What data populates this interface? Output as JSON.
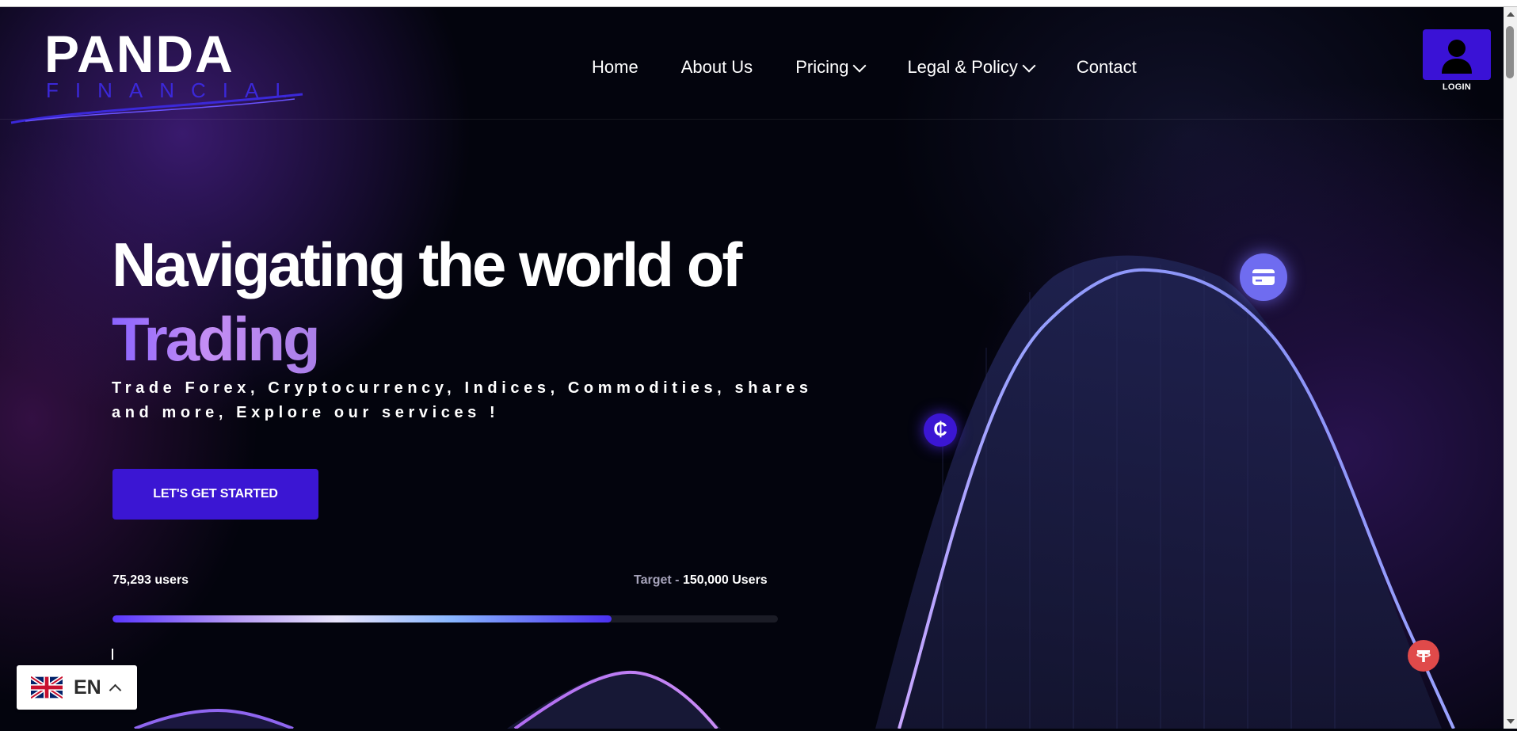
{
  "brand": {
    "name": "PANDA",
    "subtitle": "FINANCIAL"
  },
  "nav": {
    "items": [
      {
        "label": "Home",
        "dropdown": false
      },
      {
        "label": "About Us",
        "dropdown": false
      },
      {
        "label": "Pricing",
        "dropdown": true
      },
      {
        "label": "Legal & Policy",
        "dropdown": true
      },
      {
        "label": "Contact",
        "dropdown": false
      }
    ]
  },
  "login": {
    "label": "LOGIN",
    "icon": "user-icon"
  },
  "hero": {
    "headline_line1": "Navigating the world of",
    "headline_line2": "Trading",
    "subtext": "Trade Forex, Cryptocurrency, Indices, Commodities, shares and more, Explore our services !",
    "cta_label": "LET'S GET STARTED"
  },
  "progress": {
    "users_label": "75,293 users",
    "target_prefix": "Target - ",
    "target_value": "150,000 Users",
    "fraction": 0.75
  },
  "floating_icons": [
    "credit-card-icon",
    "crypto-coin-icon",
    "tether-icon"
  ],
  "language": {
    "code": "EN",
    "flag": "uk-flag-icon"
  },
  "colors": {
    "accent": "#3b16d3",
    "background": "#03040d",
    "curve": "#8d8ef5",
    "tether": "#e04a4a"
  }
}
